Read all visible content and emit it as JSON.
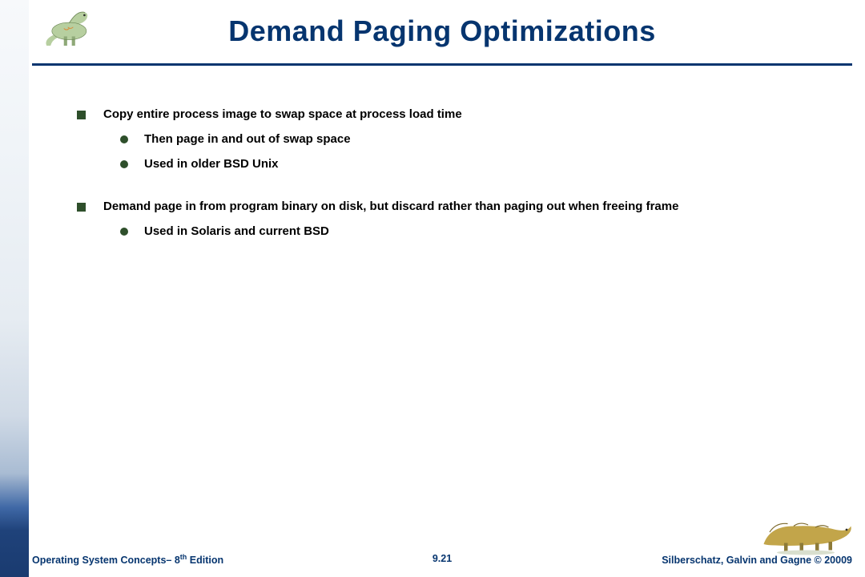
{
  "title": "Demand Paging Optimizations",
  "bullets": {
    "b1": "Copy entire process image to swap space at process load time",
    "b1a": "Then page in and out of swap space",
    "b1b": "Used in older BSD Unix",
    "b2": "Demand page in from program binary on disk, but discard rather than paging out when freeing frame",
    "b2a": "Used in Solaris and current BSD"
  },
  "footer": {
    "book_prefix": "Operating System Concepts– 8",
    "book_sup": "th",
    "book_suffix": " Edition",
    "page": "9.21",
    "copyright": "Silberschatz, Galvin and Gagne © 20009"
  }
}
